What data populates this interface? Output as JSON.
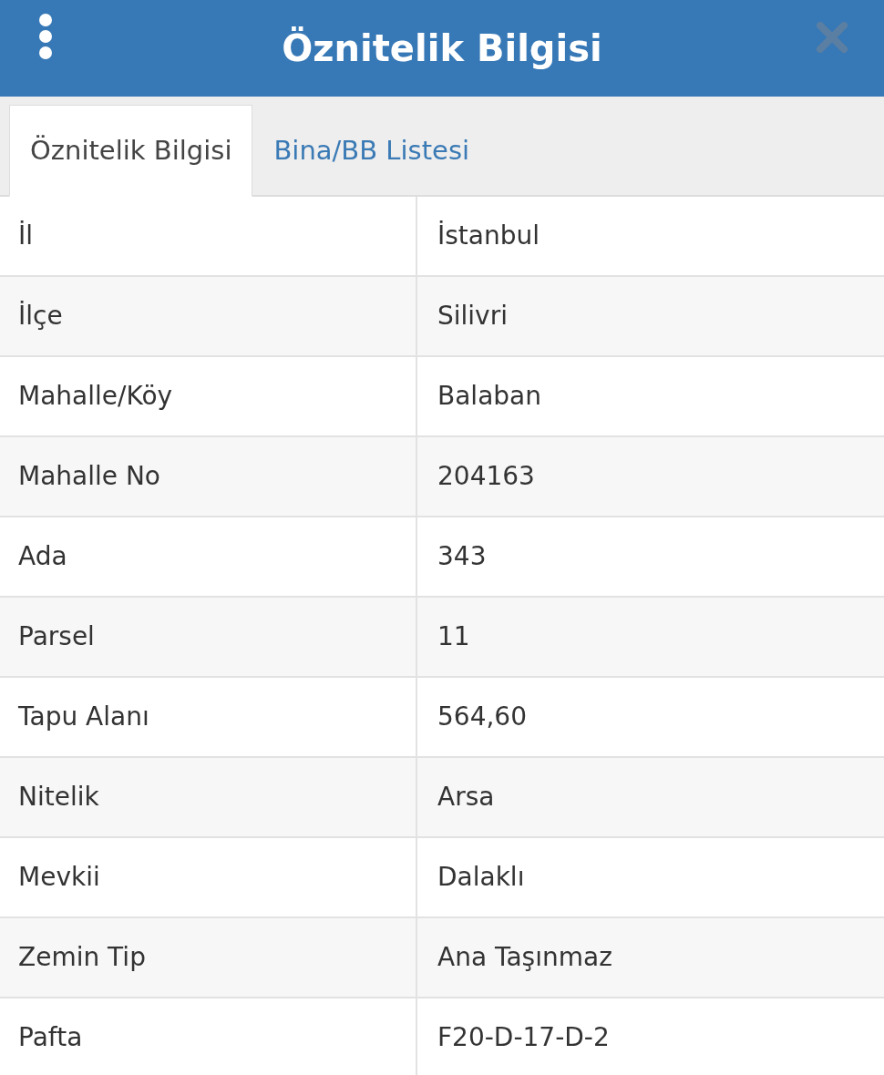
{
  "header": {
    "title": "Öznitelik Bilgisi"
  },
  "tabs": [
    {
      "label": "Öznitelik Bilgisi",
      "selected": true
    },
    {
      "label": "Bina/BB Listesi",
      "selected": false
    }
  ],
  "rows": [
    {
      "label": "İl",
      "value": "İstanbul"
    },
    {
      "label": "İlçe",
      "value": "Silivri"
    },
    {
      "label": "Mahalle/Köy",
      "value": "Balaban"
    },
    {
      "label": "Mahalle No",
      "value": "204163"
    },
    {
      "label": "Ada",
      "value": "343"
    },
    {
      "label": "Parsel",
      "value": "11"
    },
    {
      "label": "Tapu Alanı",
      "value": "564,60"
    },
    {
      "label": "Nitelik",
      "value": "Arsa"
    },
    {
      "label": "Mevkii",
      "value": "Dalaklı"
    },
    {
      "label": "Zemin Tip",
      "value": "Ana Taşınmaz"
    },
    {
      "label": "Pafta",
      "value": "F20-D-17-D-2"
    }
  ]
}
